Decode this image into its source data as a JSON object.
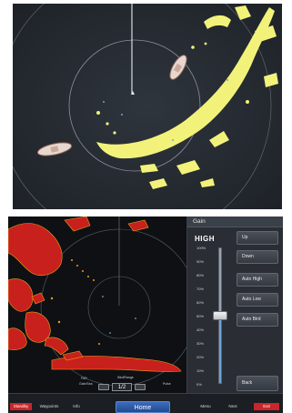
{
  "gain_panel": {
    "title": "Gain",
    "level": "HIGH",
    "slider_value": 0.5,
    "ticks": [
      "100%",
      "90%",
      "80%",
      "70%",
      "60%",
      "50%",
      "40%",
      "30%",
      "20%",
      "10%",
      "0%"
    ],
    "buttons": [
      "Up",
      "Down",
      "Auto High",
      "Auto Low",
      "Auto Bird"
    ],
    "back_label": "Back"
  },
  "range": {
    "label": "Bird/Range",
    "value": "1/2",
    "left_label": "FAR",
    "sub_left": "Gain/Sea",
    "sub_right": "Pulse"
  },
  "nav": {
    "standby": "Standby",
    "waypoints": "Waypoints",
    "info": "Info",
    "home": "Home",
    "menu": "Menu",
    "next": "Next",
    "exit": "Exit"
  },
  "colors": {
    "accent_blue": "#2e5fb2",
    "radar_yellow": "#f2f27a",
    "radar_red": "#c8201c",
    "radar_orange": "#e8a21c",
    "exit_red": "#c8262c"
  }
}
